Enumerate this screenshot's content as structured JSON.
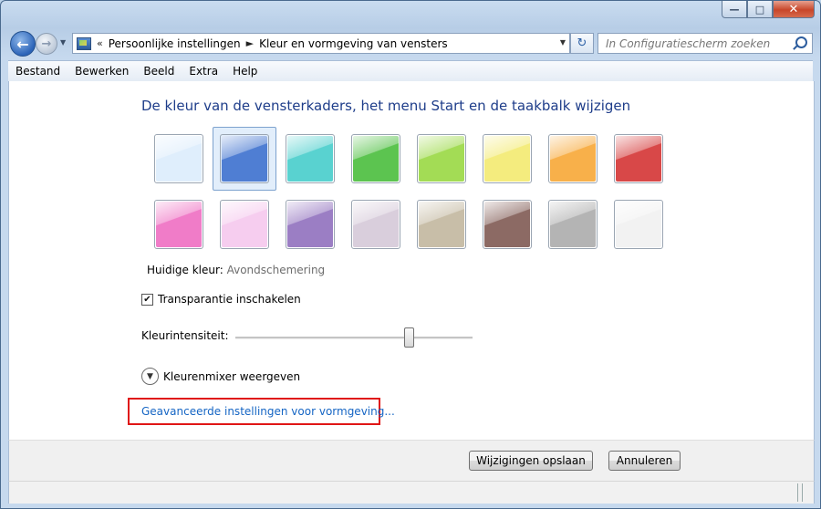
{
  "window": {
    "minimize_icon": "minimize-icon",
    "maximize_icon": "maximize-icon",
    "close_icon": "close-icon"
  },
  "nav": {
    "breadcrumbs": [
      "Persoonlijke instellingen",
      "Kleur en vormgeving van vensters"
    ],
    "overflow": "«",
    "search_placeholder": "In Configuratiescherm zoeken"
  },
  "menu": [
    "Bestand",
    "Bewerken",
    "Beeld",
    "Extra",
    "Help"
  ],
  "main": {
    "heading": "De kleur van de vensterkaders, het menu Start en de taakbalk wijzigen",
    "swatch_colors": [
      "#dfeefc",
      "#4f7ed3",
      "#59d2d0",
      "#5cc450",
      "#a3dc55",
      "#f4ec7e",
      "#f8b04a",
      "#d84848",
      "#f07cc8",
      "#f6cdef",
      "#9b7ec4",
      "#d9cedc",
      "#c8bea8",
      "#8c6a64",
      "#b4b4b4",
      "#f2f2f2"
    ],
    "selected_swatch": 1,
    "current_color_label": "Huidige kleur:",
    "current_color_value": "Avondschemering",
    "transparency_label": "Transparantie inschakelen",
    "transparency_checked": true,
    "intensity_label": "Kleurintensiteit:",
    "intensity_value": 0.73,
    "mixer_label": "Kleurenmixer weergeven",
    "advanced_link": "Geavanceerde instellingen voor vormgeving..."
  },
  "footer": {
    "save_label": "Wijzigingen opslaan",
    "cancel_label": "Annuleren"
  }
}
